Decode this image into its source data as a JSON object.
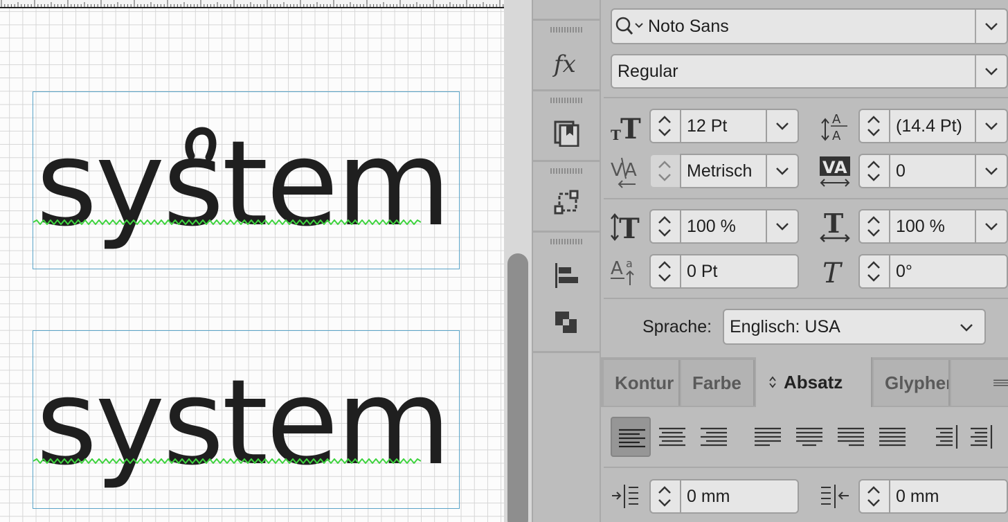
{
  "canvas": {
    "frames": [
      {
        "text": "system"
      },
      {
        "text": "system"
      }
    ]
  },
  "character": {
    "font_family": "Noto Sans",
    "font_style": "Regular",
    "font_size": "12 Pt",
    "leading": "(14.4 Pt)",
    "kerning": "Metrisch",
    "tracking": "0",
    "vertical_scale": "100 %",
    "horizontal_scale": "100 %",
    "baseline_shift": "0 Pt",
    "skew": "0°",
    "language_label": "Sprache:",
    "language": "Englisch: USA"
  },
  "tabs": [
    {
      "label": "Kontur"
    },
    {
      "label": "Farbe"
    },
    {
      "label": "Absatz",
      "active": true
    },
    {
      "label": "Glyphen"
    }
  ],
  "paragraph": {
    "left_indent": "0 mm",
    "right_indent": "0 mm"
  },
  "colors": {
    "frame_border": "#5aa4c8",
    "spellcheck_squiggle": "#3fd33f",
    "panel_bg": "#bdbdbd"
  }
}
